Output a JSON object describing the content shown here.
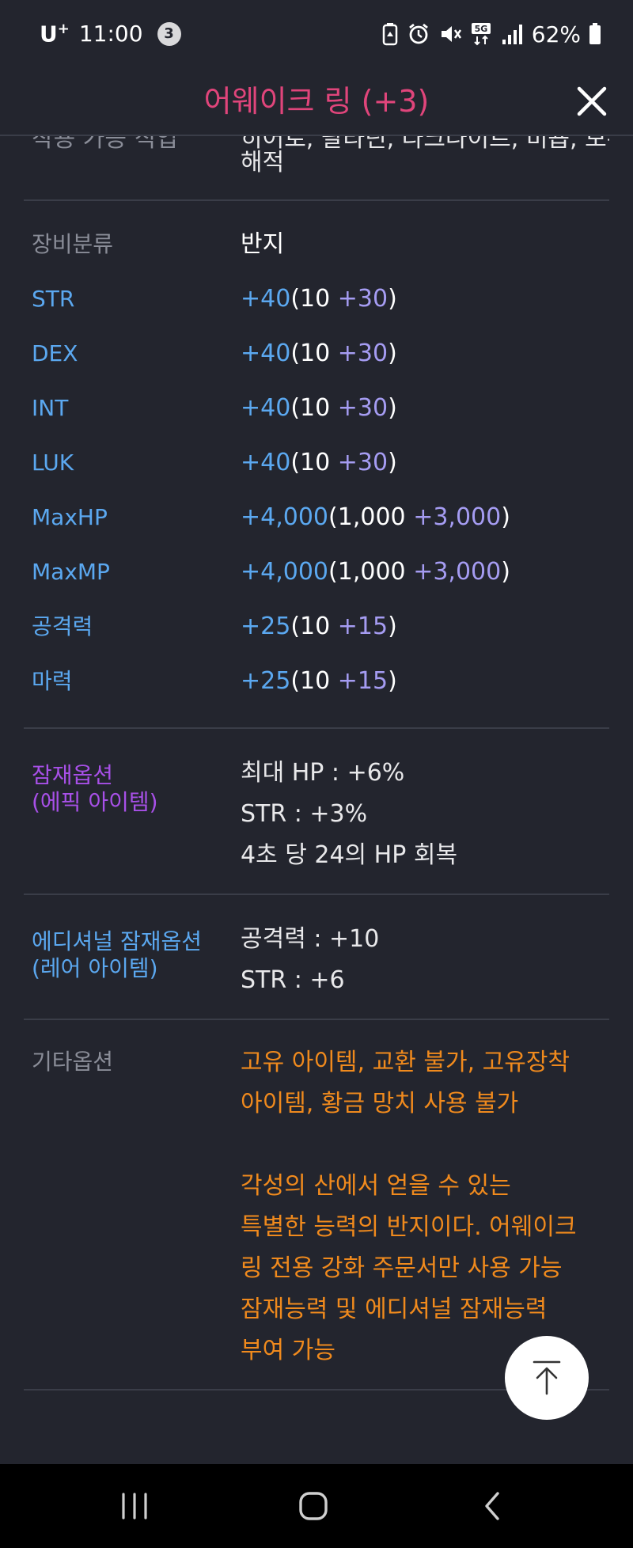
{
  "status_bar": {
    "carrier": "U",
    "carrier_sup": "+",
    "time": "11:00",
    "notification_count": "3",
    "network": "5G",
    "battery": "62%"
  },
  "header": {
    "title": "어웨이크 링 (+3)"
  },
  "partial_row": {
    "label_clipped": "착용 가능 직업",
    "value_clipped": "히어로, 팔라딘, 다크나이트, 비숍, 보우마스터,",
    "value_wrap": "해적"
  },
  "equipment": {
    "category_label": "장비분류",
    "category_value": "반지"
  },
  "stats": [
    {
      "label": "STR",
      "total": "+40",
      "base": "10",
      "bonus": "+30"
    },
    {
      "label": "DEX",
      "total": "+40",
      "base": "10",
      "bonus": "+30"
    },
    {
      "label": "INT",
      "total": "+40",
      "base": "10",
      "bonus": "+30"
    },
    {
      "label": "LUK",
      "total": "+40",
      "base": "10",
      "bonus": "+30"
    },
    {
      "label": "MaxHP",
      "total": "+4,000",
      "base": "1,000",
      "bonus": "+3,000"
    },
    {
      "label": "MaxMP",
      "total": "+4,000",
      "base": "1,000",
      "bonus": "+3,000"
    },
    {
      "label": "공격력",
      "total": "+25",
      "base": "10",
      "bonus": "+15"
    },
    {
      "label": "마력",
      "total": "+25",
      "base": "10",
      "bonus": "+15"
    }
  ],
  "potential": {
    "label_line1": "잠재옵션",
    "label_line2": "(에픽 아이템)",
    "lines": [
      "최대 HP : +6%",
      "STR : +3%",
      "4초 당 24의 HP 회복"
    ]
  },
  "additional_potential": {
    "label_line1": "에디셔널 잠재옵션",
    "label_line2": "(레어 아이템)",
    "lines": [
      "공격력 : +10",
      "STR : +6"
    ]
  },
  "etc": {
    "label": "기타옵션",
    "lines_a": [
      "고유 아이템, 교환 불가, 고유장착",
      "아이템, 황금 망치 사용 불가"
    ],
    "lines_b": [
      "각성의 산에서 얻을 수 있는",
      "특별한 능력의 반지이다. 어웨이크",
      "링 전용 강화 주문서만 사용 가능",
      "잠재능력 및 에디셔널 잠재능력",
      "부여 가능"
    ]
  },
  "colors": {
    "background": "#23252e",
    "title": "#e0457b",
    "stat_label": "#5ba8f0",
    "bonus": "#a59cf2",
    "potential_label": "#a850e8",
    "etc_text": "#f08a1d",
    "muted_label": "#8a8d98"
  },
  "icons": {
    "close": "close-icon",
    "scroll_top": "arrow-up-icon",
    "nav_recent": "recent-apps-icon",
    "nav_home": "home-icon",
    "nav_back": "back-icon"
  }
}
